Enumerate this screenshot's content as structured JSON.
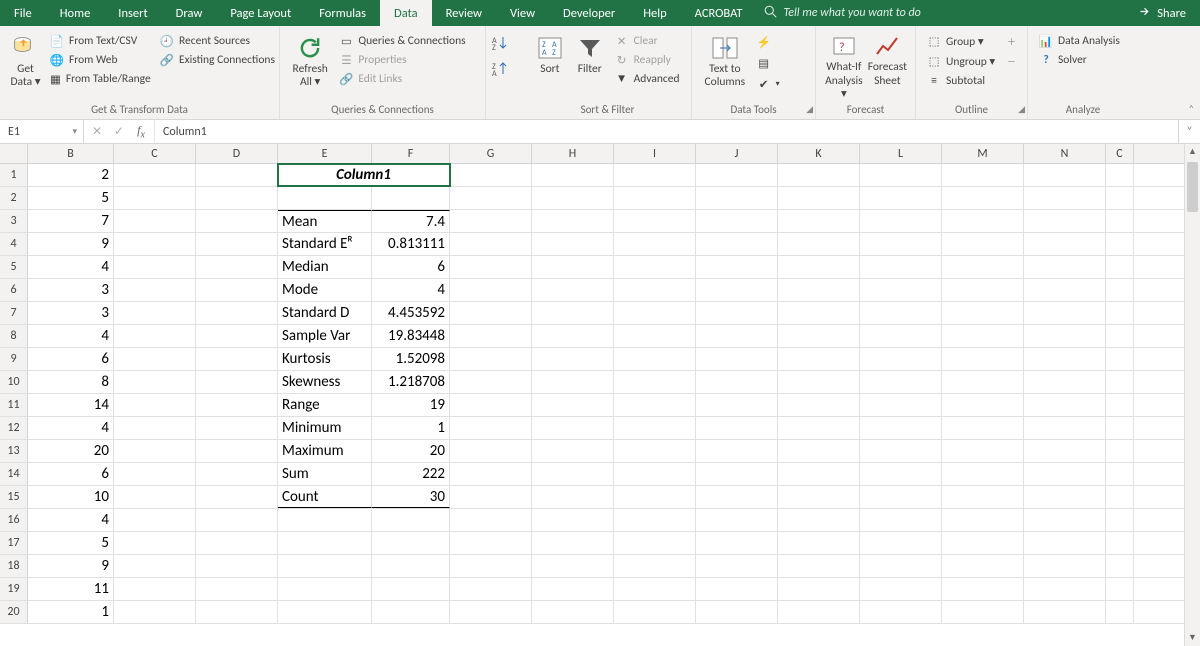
{
  "app": {
    "active_tab": "Data"
  },
  "tabs": [
    "File",
    "Home",
    "Insert",
    "Draw",
    "Page Layout",
    "Formulas",
    "Data",
    "Review",
    "View",
    "Developer",
    "Help",
    "ACROBAT"
  ],
  "tellme": "Tell me what you want to do",
  "share": "Share",
  "ribbon": {
    "getdata": {
      "label": "Get\nData ▾",
      "group": "Get & Transform Data",
      "items": [
        "From Text/CSV",
        "From Web",
        "From Table/Range",
        "Recent Sources",
        "Existing Connections"
      ]
    },
    "refresh": {
      "label": "Refresh\nAll ▾",
      "group": "Queries & Connections",
      "items": [
        "Queries & Connections",
        "Properties",
        "Edit Links"
      ]
    },
    "sortfilter": {
      "group": "Sort & Filter",
      "sort": "Sort",
      "filter": "Filter",
      "items": [
        "Clear",
        "Reapply",
        "Advanced"
      ]
    },
    "ttc": {
      "label": "Text to\nColumns",
      "group": "Data Tools"
    },
    "whatif": {
      "label": "What-If\nAnalysis ▾"
    },
    "forecast": {
      "label": "Forecast\nSheet",
      "group": "Forecast"
    },
    "outline": {
      "group": "Outline",
      "items": [
        "Group  ▾",
        "Ungroup  ▾",
        "Subtotal"
      ]
    },
    "analyze": {
      "group": "Analyze",
      "items": [
        "Data Analysis",
        "Solver"
      ]
    }
  },
  "formula_bar": {
    "name": "E1",
    "value": "Column1"
  },
  "columns": [
    {
      "l": "B",
      "w": 86
    },
    {
      "l": "C",
      "w": 82
    },
    {
      "l": "D",
      "w": 82
    },
    {
      "l": "E",
      "w": 94
    },
    {
      "l": "F",
      "w": 78
    },
    {
      "l": "G",
      "w": 82
    },
    {
      "l": "H",
      "w": 82
    },
    {
      "l": "I",
      "w": 82
    },
    {
      "l": "J",
      "w": 82
    },
    {
      "l": "K",
      "w": 82
    },
    {
      "l": "L",
      "w": 82
    },
    {
      "l": "M",
      "w": 82
    },
    {
      "l": "N",
      "w": 82
    },
    {
      "l": "C2",
      "w": 28
    }
  ],
  "col_b": [
    2,
    5,
    7,
    9,
    4,
    3,
    3,
    4,
    6,
    8,
    14,
    4,
    20,
    6,
    10,
    4,
    5,
    9,
    11,
    1
  ],
  "stats_title": "Column1",
  "stats": [
    {
      "k": "Mean",
      "v": "7.4"
    },
    {
      "k": "Standard Eᴿ",
      "v": "0.813111"
    },
    {
      "k": "Median",
      "v": "6"
    },
    {
      "k": "Mode",
      "v": "4"
    },
    {
      "k": "Standard D",
      "v": "4.453592"
    },
    {
      "k": "Sample Var",
      "v": "19.83448"
    },
    {
      "k": "Kurtosis",
      "v": "1.52098"
    },
    {
      "k": "Skewness",
      "v": "1.218708"
    },
    {
      "k": "Range",
      "v": "19"
    },
    {
      "k": "Minimum",
      "v": "1"
    },
    {
      "k": "Maximum",
      "v": "20"
    },
    {
      "k": "Sum",
      "v": "222"
    },
    {
      "k": "Count",
      "v": "30"
    }
  ],
  "chart_data": {
    "type": "table",
    "title": "Column1 – Descriptive Statistics",
    "series": [
      {
        "name": "Mean",
        "values": [
          7.4
        ]
      },
      {
        "name": "Standard Error",
        "values": [
          0.813111
        ]
      },
      {
        "name": "Median",
        "values": [
          6
        ]
      },
      {
        "name": "Mode",
        "values": [
          4
        ]
      },
      {
        "name": "Standard Deviation",
        "values": [
          4.453592
        ]
      },
      {
        "name": "Sample Variance",
        "values": [
          19.83448
        ]
      },
      {
        "name": "Kurtosis",
        "values": [
          1.52098
        ]
      },
      {
        "name": "Skewness",
        "values": [
          1.218708
        ]
      },
      {
        "name": "Range",
        "values": [
          19
        ]
      },
      {
        "name": "Minimum",
        "values": [
          1
        ]
      },
      {
        "name": "Maximum",
        "values": [
          20
        ]
      },
      {
        "name": "Sum",
        "values": [
          222
        ]
      },
      {
        "name": "Count",
        "values": [
          30
        ]
      }
    ],
    "raw_column_B": [
      2,
      5,
      7,
      9,
      4,
      3,
      3,
      4,
      6,
      8,
      14,
      4,
      20,
      6,
      10,
      4,
      5,
      9,
      11,
      1
    ]
  }
}
